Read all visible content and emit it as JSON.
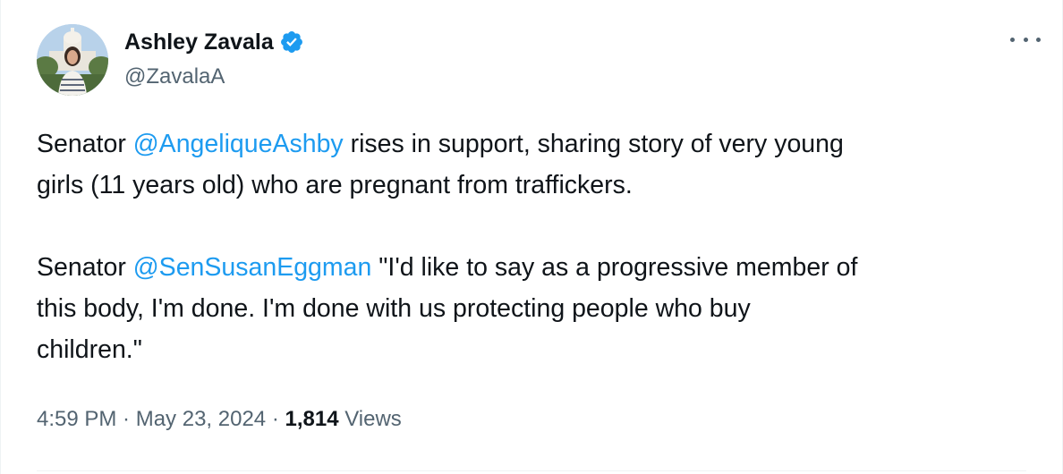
{
  "author": {
    "display_name": "Ashley Zavala",
    "handle": "@ZavalaA",
    "verified": true,
    "verified_color": "#1d9bf0",
    "avatar_icon": "profile-photo"
  },
  "menu": {
    "icon": "more-icon"
  },
  "tweet": {
    "p1_prefix": "Senator ",
    "p1_mention": "@AngeliqueAshby",
    "p1_line1_suffix": " rises in support, sharing story of very young",
    "p1_line2": "girls (11 years old) who are pregnant from traffickers.",
    "p2_prefix": "Senator ",
    "p2_mention": "@SenSusanEggman",
    "p2_line1_suffix": " \"I'd like to say as a progressive member of",
    "p2_line2": "this body, I'm done. I'm done with us protecting people who buy",
    "p2_line3": "children.\""
  },
  "meta": {
    "time": "4:59 PM",
    "separator": " · ",
    "date": "May 23, 2024",
    "views_count": "1,814",
    "views_label": " Views"
  },
  "colors": {
    "text": "#0f1419",
    "secondary": "#536471",
    "link": "#1d9bf0"
  }
}
